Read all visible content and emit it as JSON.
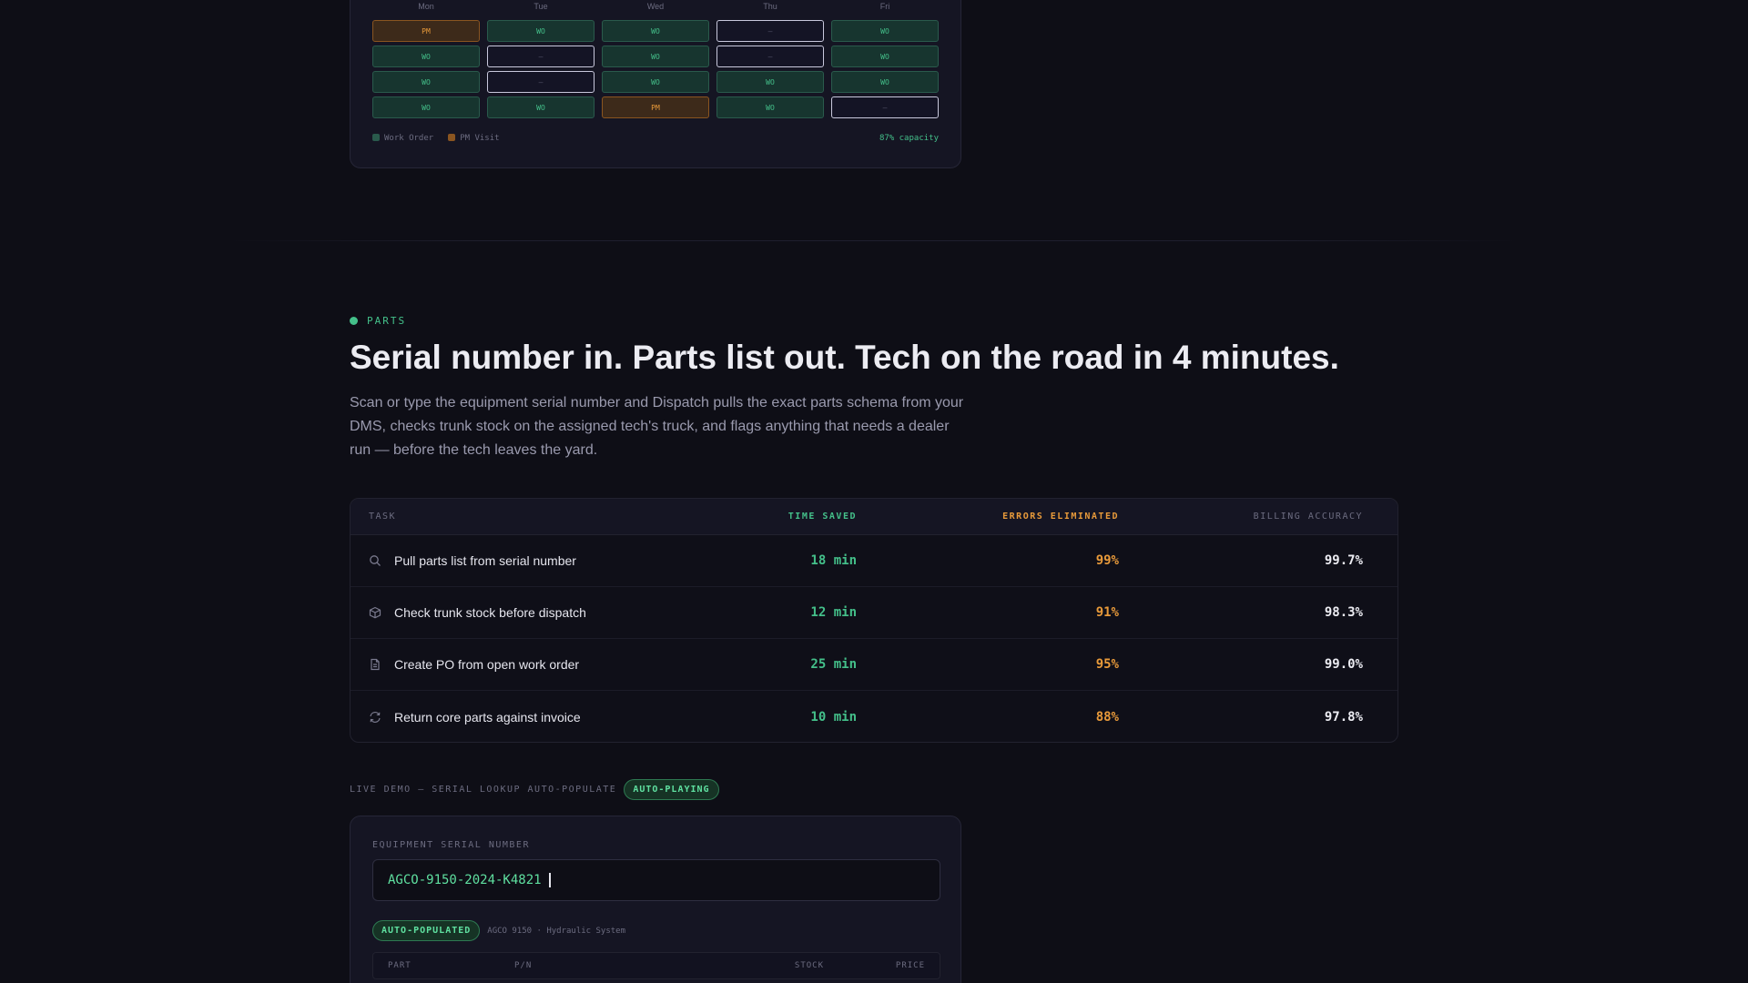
{
  "schedule": {
    "days": [
      "Mon",
      "Tue",
      "Wed",
      "Thu",
      "Fri"
    ],
    "rows": [
      [
        {
          "type": "pm",
          "label": "PM"
        },
        {
          "type": "wo",
          "label": "WO"
        },
        {
          "type": "wo",
          "label": "WO"
        },
        {
          "type": "empty",
          "label": "—"
        },
        {
          "type": "wo",
          "label": "WO"
        }
      ],
      [
        {
          "type": "wo",
          "label": "WO"
        },
        {
          "type": "empty",
          "label": "—"
        },
        {
          "type": "wo",
          "label": "WO"
        },
        {
          "type": "empty",
          "label": "—"
        },
        {
          "type": "wo",
          "label": "WO"
        }
      ],
      [
        {
          "type": "wo",
          "label": "WO"
        },
        {
          "type": "empty",
          "label": "—"
        },
        {
          "type": "wo",
          "label": "WO"
        },
        {
          "type": "wo",
          "label": "WO"
        },
        {
          "type": "wo",
          "label": "WO"
        }
      ],
      [
        {
          "type": "wo",
          "label": "WO"
        },
        {
          "type": "wo",
          "label": "WO"
        },
        {
          "type": "pm",
          "label": "PM"
        },
        {
          "type": "wo",
          "label": "WO"
        },
        {
          "type": "empty",
          "label": "—"
        }
      ]
    ],
    "legend": {
      "work_order": "Work Order",
      "pm_visit": "PM Visit"
    },
    "capacity": "87% capacity",
    "colors": {
      "work_order": "#2a5a4c",
      "pm_visit": "#8a5520"
    }
  },
  "section": {
    "eyebrow": "PARTS",
    "headline": "Serial number in. Parts list out. Tech on the road in 4 minutes.",
    "lede": "Scan or type the equipment serial number and Dispatch pulls the exact parts schema from your DMS, checks trunk stock on the assigned tech's truck, and flags anything that needs a dealer run — before the tech leaves the yard."
  },
  "table": {
    "headers": {
      "task": "TASK",
      "time": "TIME SAVED",
      "errors": "ERRORS ELIMINATED",
      "billing": "BILLING ACCURACY"
    },
    "rows": [
      {
        "icon": "search-icon",
        "task": "Pull parts list from serial number",
        "time": "18 min",
        "errors": "99%",
        "billing": "99.7%"
      },
      {
        "icon": "box-icon",
        "task": "Check trunk stock before dispatch",
        "time": "12 min",
        "errors": "91%",
        "billing": "98.3%"
      },
      {
        "icon": "document-icon",
        "task": "Create PO from open work order",
        "time": "25 min",
        "errors": "95%",
        "billing": "99.0%"
      },
      {
        "icon": "refresh-icon",
        "task": "Return core parts against invoice",
        "time": "10 min",
        "errors": "88%",
        "billing": "97.8%"
      }
    ]
  },
  "demo": {
    "label": "LIVE DEMO — SERIAL LOOKUP AUTO-POPULATE",
    "badge": "AUTO-PLAYING",
    "field_label": "EQUIPMENT SERIAL NUMBER",
    "serial_value": "AGCO-9150-2024-K4821",
    "auto_badge": "AUTO-POPULATED",
    "auto_meta": "AGCO 9150 · Hydraulic System",
    "parts_headers": {
      "part": "PART",
      "pn": "P/N",
      "stock": "STOCK",
      "price": "PRICE"
    }
  },
  "accent_colors": {
    "green": "#44c08a",
    "orange": "#e89a3a",
    "background": "#0e0e16"
  }
}
